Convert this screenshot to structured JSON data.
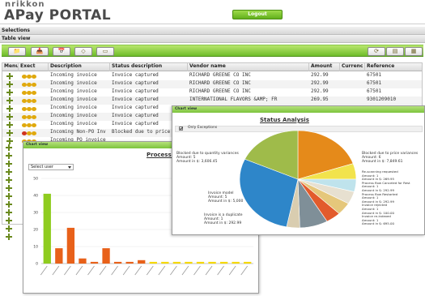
{
  "header": {
    "logo_top": "nrikkon",
    "logo_main": "APay PORTAL",
    "logout": "Logout"
  },
  "sections": {
    "selections": "Selections",
    "table_view": "Table view"
  },
  "toolbar": {
    "left_icons": [
      "open-folder-icon",
      "inbox-icon",
      "calendar-icon",
      "tag-icon",
      "document-icon"
    ],
    "right_icons": [
      "refresh-icon",
      "export-icon",
      "table-icon"
    ]
  },
  "grid": {
    "columns": [
      "Menu",
      "Exect",
      "Description",
      "Status description",
      "Vendor name",
      "Amount",
      "Currenc",
      "Reference"
    ],
    "rows": [
      {
        "dots": [
          "yellow",
          "yellow",
          "yellow"
        ],
        "description": "Incoming invoice",
        "status": "Invoice captured",
        "vendor": "RICHARD GREENE CO INC",
        "amount": "292.99",
        "currency": "",
        "reference": "67501"
      },
      {
        "dots": [
          "yellow",
          "yellow",
          "yellow"
        ],
        "description": "Incoming invoice",
        "status": "Invoice captured",
        "vendor": "RICHARD GREENE CO INC",
        "amount": "292.99",
        "currency": "",
        "reference": "67501"
      },
      {
        "dots": [
          "yellow",
          "yellow",
          "yellow"
        ],
        "description": "Incoming invoice",
        "status": "Invoice captured",
        "vendor": "RICHARD GREENE CO INC",
        "amount": "292.99",
        "currency": "",
        "reference": "67501"
      },
      {
        "dots": [
          "yellow",
          "yellow",
          "yellow"
        ],
        "description": "Incoming invoice",
        "status": "Invoice captured",
        "vendor": "INTERNATIONAL FLAVORS &AMP; FR",
        "amount": "269.95",
        "currency": "",
        "reference": "9301209010"
      },
      {
        "dots": [
          "yellow",
          "yellow",
          "yellow"
        ],
        "description": "Incoming invoice",
        "status": "Invoice captured",
        "vendor": "",
        "amount": "",
        "currency": "",
        "reference": ""
      },
      {
        "dots": [
          "yellow",
          "yellow",
          "yellow"
        ],
        "description": "Incoming invoice",
        "status": "Invoice captured",
        "vendor": "",
        "amount": "",
        "currency": "",
        "reference": ""
      },
      {
        "dots": [
          "yellow",
          "yellow",
          "yellow"
        ],
        "description": "Incoming invoice",
        "status": "Invoice captured",
        "vendor": "",
        "amount": "",
        "currency": "",
        "reference": ""
      },
      {
        "dots": [
          "red",
          "yellow",
          "yellow"
        ],
        "description": "Incoming Non-PO Inv",
        "status": "Blocked due to price v",
        "vendor": "",
        "amount": "",
        "currency": "",
        "reference": ""
      },
      {
        "dots": [
          "yellow",
          "yellow",
          "yellow"
        ],
        "description": "Incoming PO invoice",
        "status": "",
        "vendor": "",
        "amount": "",
        "currency": "",
        "reference": ""
      }
    ]
  },
  "left_chart": {
    "window_title": "Chart view",
    "title": "Processi",
    "select_label": "Select user"
  },
  "right_chart": {
    "window_title": "Chart view",
    "title": "Status Analysis",
    "checkbox_label": "Only Exceptions"
  },
  "chart_data": [
    {
      "type": "bar",
      "title": "Processi",
      "ylim": [
        0,
        50
      ],
      "yticks": [
        0,
        10,
        20,
        30,
        40,
        50
      ],
      "values": [
        41,
        9,
        21,
        3,
        1,
        9,
        1,
        1,
        2,
        1,
        1,
        1,
        1,
        1,
        1,
        1,
        1,
        1
      ],
      "colors": [
        "#8fcc1f",
        "#e8611a",
        "#e8611a",
        "#e8611a",
        "#e8611a",
        "#e8611a",
        "#e8611a",
        "#e8611a",
        "#e8611a",
        "#f5d800",
        "#f5d800",
        "#f5d800",
        "#f5d800",
        "#f5d800",
        "#f5d800",
        "#f5d800",
        "#f5d800",
        "#f5d800"
      ]
    },
    {
      "type": "pie",
      "title": "Status Analysis",
      "slices": [
        {
          "label": "Blocked due to price variances",
          "value": 7.6,
          "color": "#e58a1a"
        },
        {
          "label": "Re-scanning requested",
          "value": 2.0,
          "color": "#f2e34c"
        },
        {
          "label": "Process flow Canceled for Rest",
          "value": 1.6,
          "color": "#bfe3ec"
        },
        {
          "label": "Process flow Restarted",
          "value": 1.6,
          "color": "#e7e0d0"
        },
        {
          "label": "Invoice rejected",
          "value": 1.6,
          "color": "#e5c77b"
        },
        {
          "label": "Invoice re-indexed",
          "value": 1.6,
          "color": "#e25b2c"
        },
        {
          "label": "Invoice is a duplicate",
          "value": 3.0,
          "color": "#7f8f98"
        },
        {
          "label": "Invoice rejected slice",
          "value": 1.4,
          "color": "#d9cdb0"
        },
        {
          "label": "Invoice model",
          "value": 11.0,
          "color": "#2e86c9"
        },
        {
          "label": "Blocked due to quantity variances",
          "value": 7.0,
          "color": "#9fbb4a"
        }
      ]
    }
  ],
  "pie_annotations": {
    "price_var": [
      "Blocked due to price variances",
      "Amount: 6",
      "Amount in $: 7,849.61"
    ],
    "qty_var": [
      "Blocked due to quantity variances",
      "Amount: 5",
      "Amount in $: 3,606.45"
    ],
    "model": [
      "Invoice model",
      "Amount: 5",
      "Amount in $: 5,000"
    ],
    "duplicate": [
      "Invoice is a duplicate",
      "Amount: 1",
      "Amount in $: 292.99"
    ],
    "right_block": [
      "Re-scanning requested",
      "Amount: 1",
      "Amount in $: 269.95",
      "Process flow Canceled for Rest",
      "Amount: 1",
      "Amount in $: 292.99",
      "Process flow Restarted",
      "Amount: 1",
      "Amount in $: 292.99",
      "Invoice rejected",
      "Amount: 1",
      "Amount in $: 100.00",
      "Invoice re-indexed",
      "Amount: 1",
      "Amount in $: 695.00"
    ]
  }
}
